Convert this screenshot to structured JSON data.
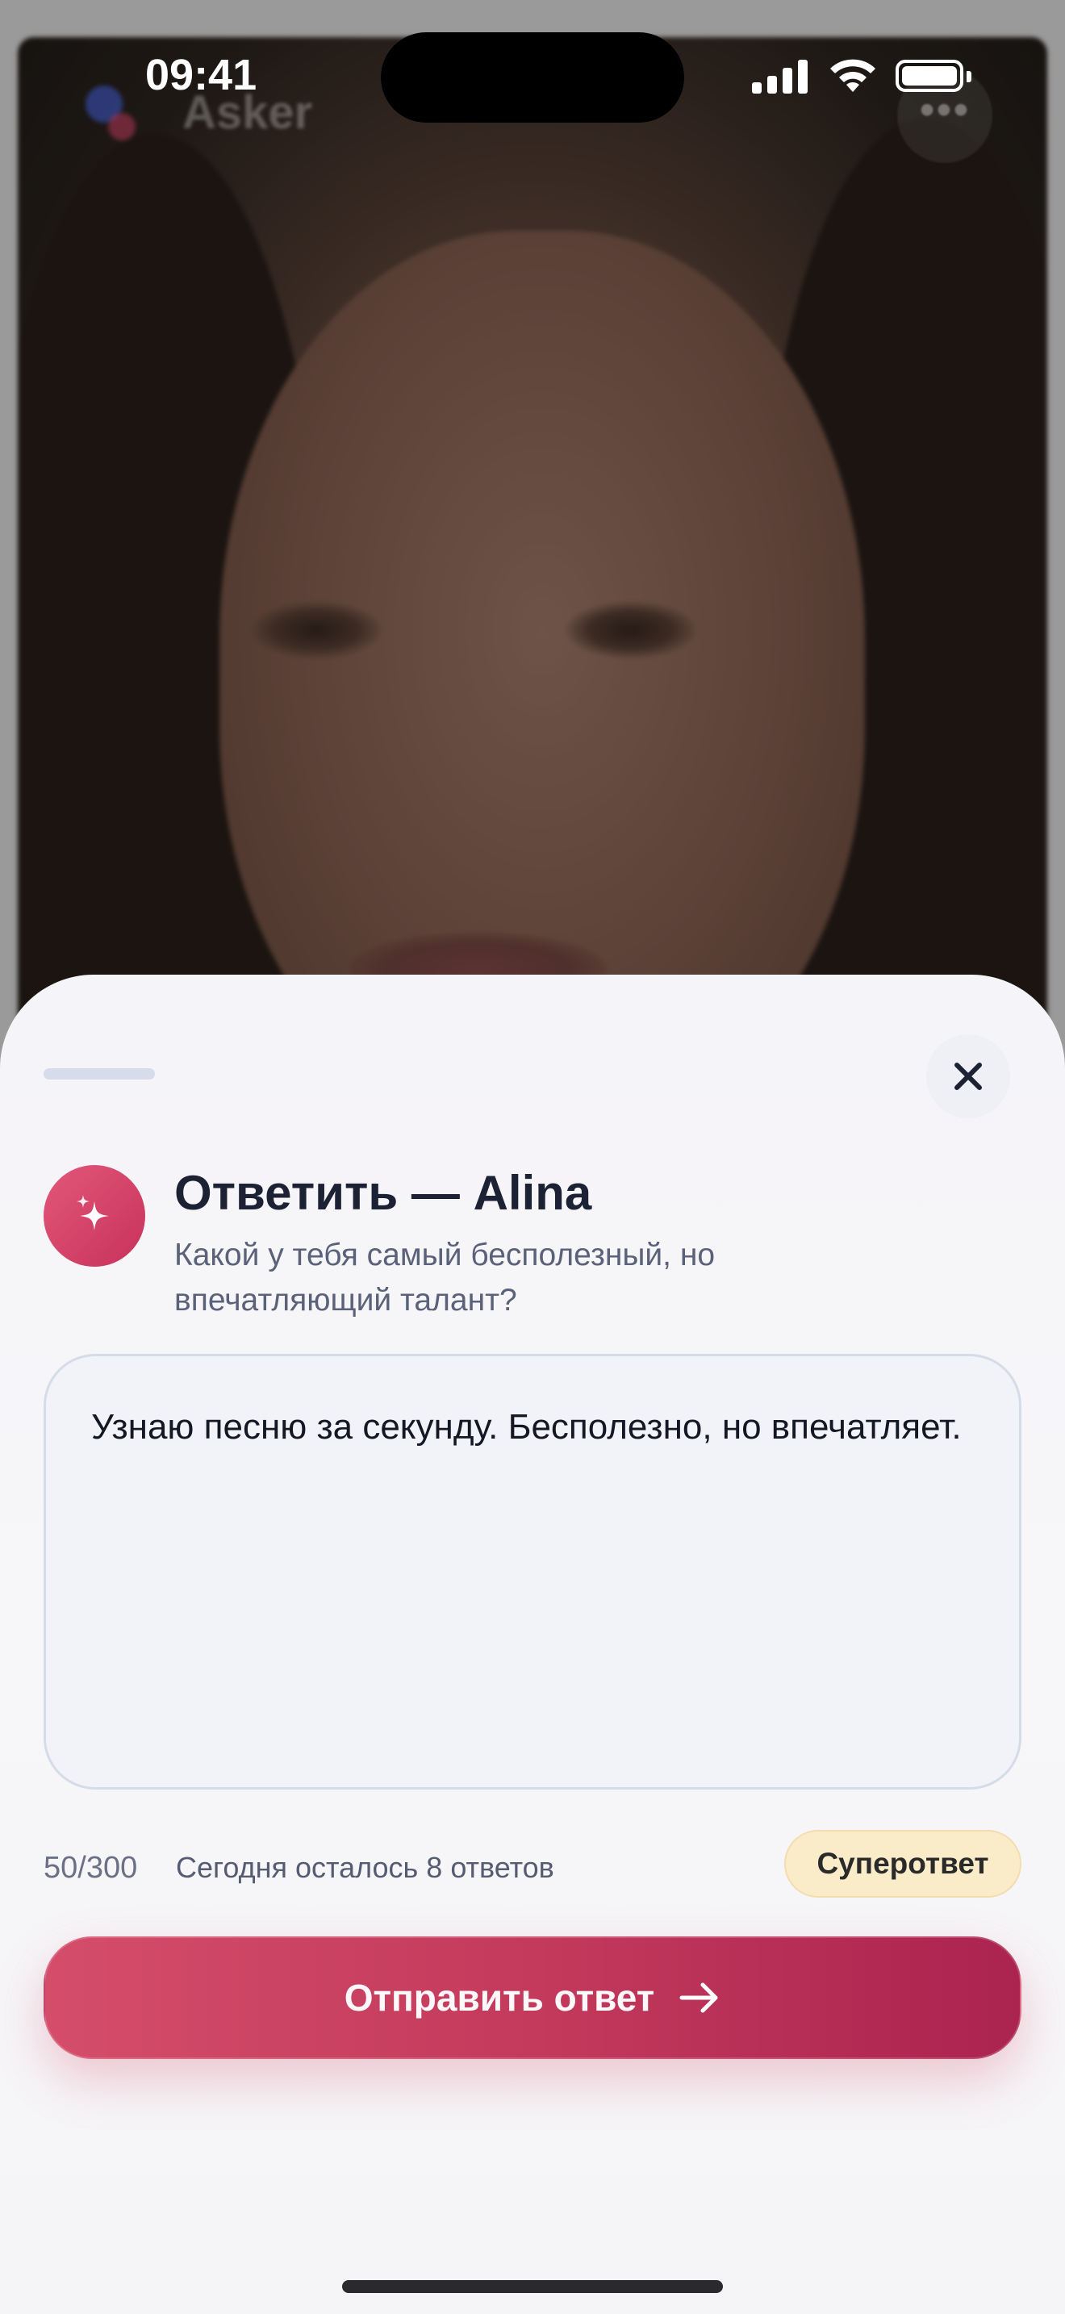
{
  "status_bar": {
    "time": "09:41"
  },
  "background_app": {
    "name": "Asker",
    "more_icon": "ellipsis-icon"
  },
  "sheet": {
    "title": "Ответить — Alina",
    "question": "Какой у тебя самый бесполезный, но впечатляющий талант?",
    "answer_text": "Узнаю песню за секунду. Бесполезно, но впечатляет.",
    "char_counter": "50/300",
    "remaining_text": "Сегодня осталось 8 ответов",
    "super_answer_label": "Суперответ",
    "send_label": "Отправить ответ",
    "icons": {
      "close": "close-icon",
      "badge": "sparkles-icon",
      "send": "arrow-right-icon"
    }
  },
  "colors": {
    "accent_start": "#d44d6a",
    "accent_end": "#ab2350",
    "super_bg": "#fbecc9",
    "title": "#1c2133"
  }
}
